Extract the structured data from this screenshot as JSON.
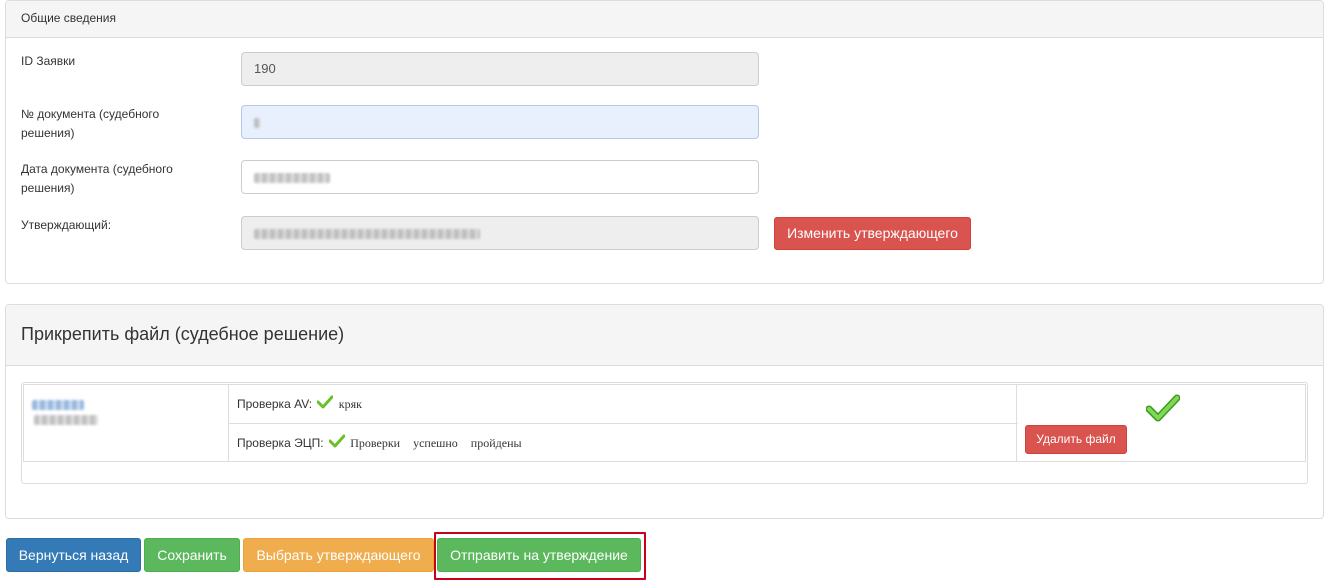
{
  "general": {
    "heading": "Общие сведения",
    "fields": [
      {
        "label": "ID Заявки",
        "value": "190"
      },
      {
        "label": "№ документа (судебного решения)",
        "value": ""
      },
      {
        "label": "Дата документа (судебного решения)",
        "value": ""
      },
      {
        "label": "Утверждающий:",
        "value": ""
      }
    ],
    "change_approver_label": "Изменить утверждающего"
  },
  "attach": {
    "heading": "Прикрепить файл (судебное решение)",
    "av_label": "Проверка AV:",
    "av_result": "кряк",
    "eds_label": "Проверка ЭЦП:",
    "eds_result": "Проверки успешно пройдены",
    "delete_label": "Удалить файл"
  },
  "actions": {
    "back": "Вернуться назад",
    "save": "Сохранить",
    "choose_approver": "Выбрать утверждающего",
    "send_for_approval": "Отправить на утверждение"
  },
  "colors": {
    "danger": "#d9534f",
    "success": "#5cb85c",
    "primary": "#337ab7",
    "warning": "#f0ad4e",
    "highlight": "#c9001a",
    "check": "#6abf2a"
  },
  "icons": {
    "av_check": "check-icon",
    "eds_check": "check-icon",
    "file_status": "large-check-icon"
  }
}
